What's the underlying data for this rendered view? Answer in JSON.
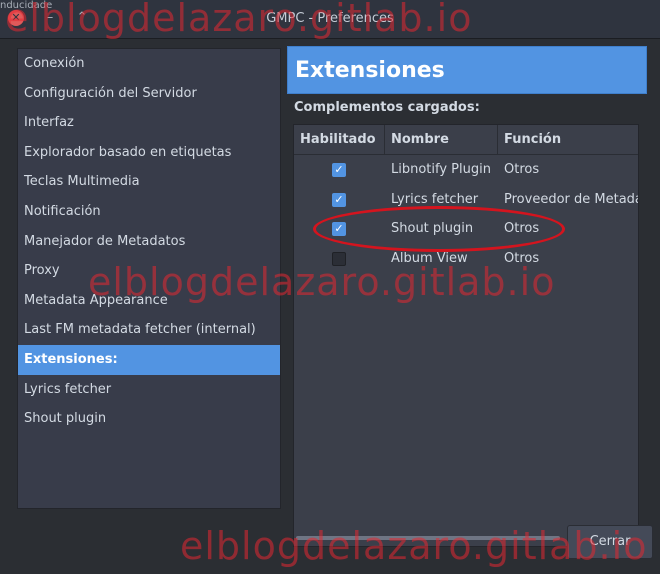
{
  "window": {
    "title": "GMPC - Preferences",
    "top_left_fragment": "nducidade"
  },
  "sidebar": {
    "items": [
      {
        "label": "Conexión",
        "selected": false
      },
      {
        "label": "Configuración del Servidor",
        "selected": false
      },
      {
        "label": "Interfaz",
        "selected": false
      },
      {
        "label": "Explorador basado en etiquetas",
        "selected": false
      },
      {
        "label": "Teclas Multimedia",
        "selected": false
      },
      {
        "label": "Notificación",
        "selected": false
      },
      {
        "label": "Manejador de Metadatos",
        "selected": false
      },
      {
        "label": "Proxy",
        "selected": false
      },
      {
        "label": "Metadata Appearance",
        "selected": false
      },
      {
        "label": "Last FM metadata fetcher (internal)",
        "selected": false
      },
      {
        "label": "Extensiones:",
        "selected": true
      },
      {
        "label": "Lyrics fetcher",
        "selected": false
      },
      {
        "label": "Shout plugin",
        "selected": false
      }
    ]
  },
  "panel": {
    "title": "Extensiones",
    "section_label": "Complementos cargados:",
    "columns": [
      "Habilitado",
      "Nombre",
      "Función"
    ],
    "rows": [
      {
        "enabled": true,
        "name": "Libnotify Plugin",
        "function": "Otros"
      },
      {
        "enabled": true,
        "name": "Lyrics fetcher",
        "function": "Proveedor de Metadatos"
      },
      {
        "enabled": true,
        "name": "Shout plugin",
        "function": "Otros"
      },
      {
        "enabled": false,
        "name": "Album View",
        "function": "Otros"
      }
    ]
  },
  "buttons": {
    "close_label": "Cerrar"
  },
  "watermark": "elblogdelazaro.gitlab.io",
  "colors": {
    "accent": "#5294e2",
    "highlight_oval": "#d4141e",
    "watermark": "#e42832"
  }
}
